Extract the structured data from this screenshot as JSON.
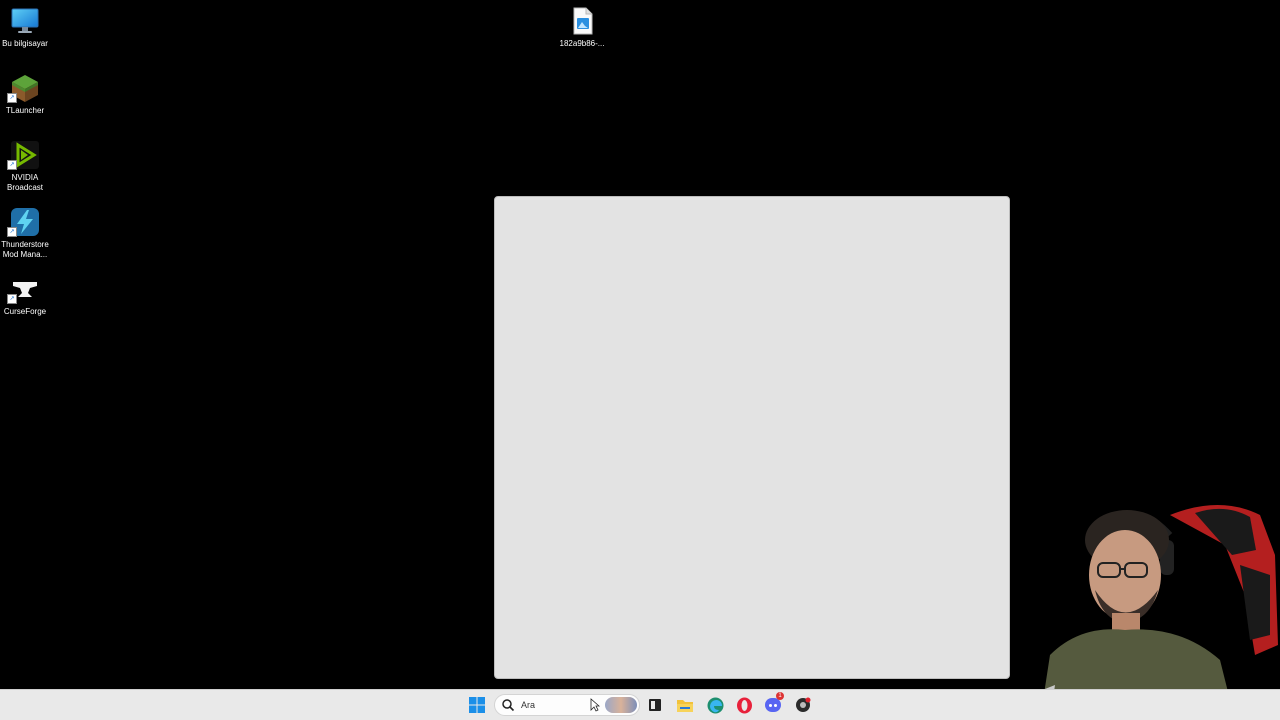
{
  "desktop": {
    "icons": [
      {
        "label": "Bu bilgisayar",
        "icon": "monitor-icon"
      },
      {
        "label": "TLauncher",
        "icon": "minecraft-grass-block-icon"
      },
      {
        "label": "NVIDIA\nBroadcast",
        "icon": "nvidia-broadcast-icon"
      },
      {
        "label": "Thunderstore\nMod Mana...",
        "icon": "thunderstore-icon"
      },
      {
        "label": "CurseForge",
        "icon": "curseforge-anvil-icon"
      },
      {
        "label": "182a9b86-...",
        "icon": "image-file-icon"
      }
    ]
  },
  "window": {
    "state": "blank"
  },
  "taskbar": {
    "search_placeholder": "Ara",
    "items": [
      {
        "name": "start",
        "icon": "windows-start-icon"
      },
      {
        "name": "task-view",
        "icon": "task-view-icon"
      },
      {
        "name": "file-explorer",
        "icon": "folder-icon"
      },
      {
        "name": "edge",
        "icon": "edge-icon"
      },
      {
        "name": "opera",
        "icon": "opera-icon"
      },
      {
        "name": "discord",
        "icon": "discord-icon",
        "badge": "1"
      },
      {
        "name": "app",
        "icon": "app-icon"
      }
    ]
  },
  "colors": {
    "desktop_bg": "#000000",
    "taskbar_bg": "#e9e9e9",
    "window_bg": "#e3e3e3"
  }
}
